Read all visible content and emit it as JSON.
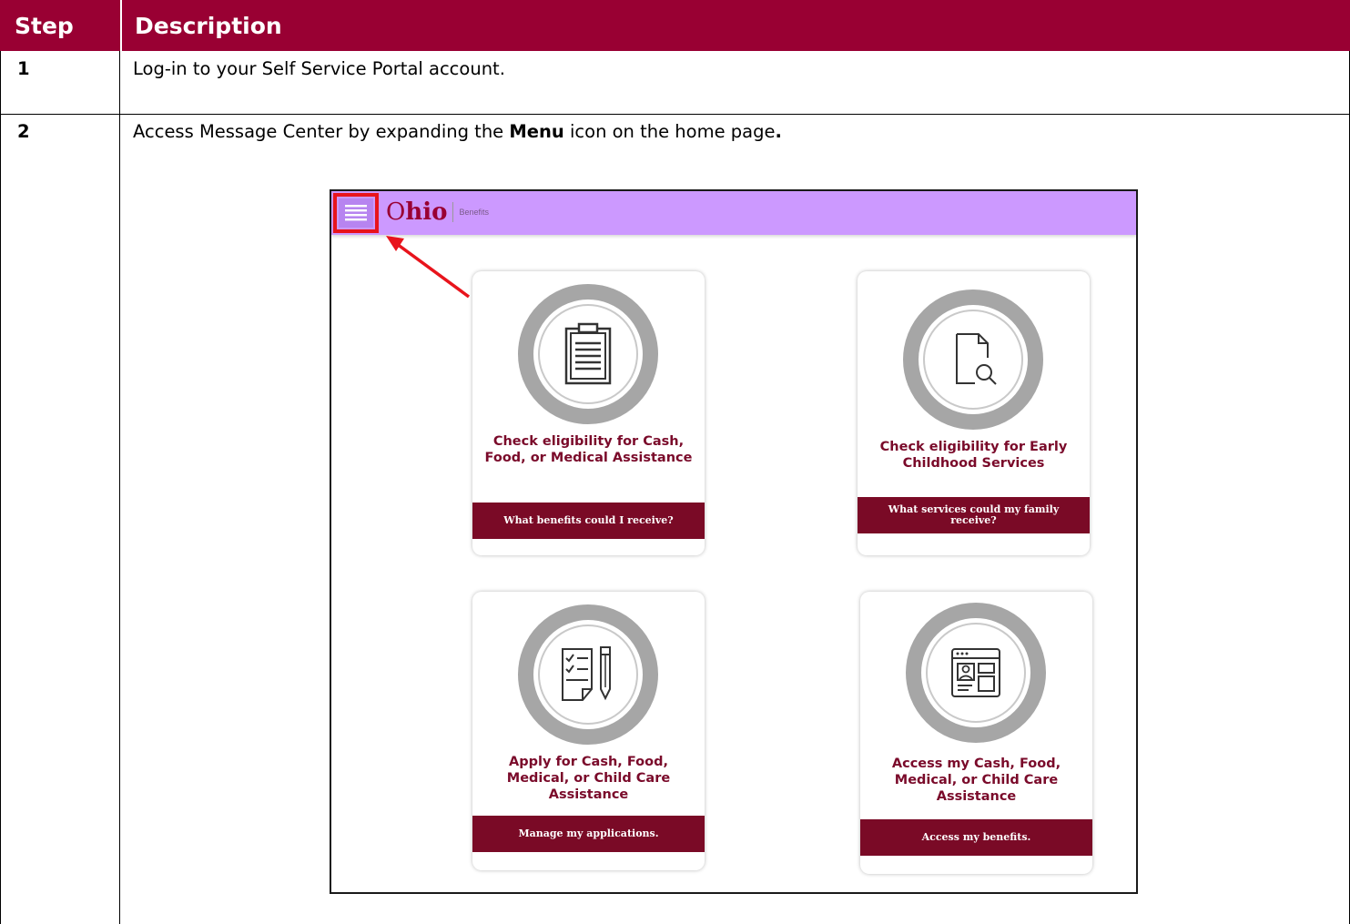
{
  "table": {
    "header_step": "Step",
    "header_description": "Description",
    "rows": [
      {
        "step": "1",
        "text": "Log-in to your Self Service Portal account."
      },
      {
        "step": "2",
        "text_before": "Access Message Center by expanding the ",
        "text_bold": "Menu",
        "text_after": " icon on the home page",
        "text_end": "."
      }
    ]
  },
  "portal": {
    "logo_letter": "O",
    "logo_rest": "hio",
    "logo_sub": "Benefits",
    "cards": [
      {
        "title": "Check eligibility for Cash, Food, or Medical Assistance",
        "button": "What benefits could I receive?",
        "icon": "clipboard-icon"
      },
      {
        "title": "Check eligibility for Early Childhood Services",
        "button": "What services could my family receive?",
        "icon": "document-search-icon"
      },
      {
        "title": "Apply for Cash, Food, Medical, or Child Care Assistance",
        "button": "Manage my applications.",
        "icon": "checklist-pen-icon"
      },
      {
        "title": "Access my Cash, Food, Medical, or Child Care Assistance",
        "button": "Access my benefits.",
        "icon": "browser-profile-icon"
      }
    ]
  },
  "colors": {
    "header_bg": "#990033",
    "topbar_bg": "#cc99ff",
    "highlight": "#e8141c",
    "card_button": "#7a0a26",
    "card_title": "#7a0a2a",
    "ring": "#a6a6a6"
  }
}
